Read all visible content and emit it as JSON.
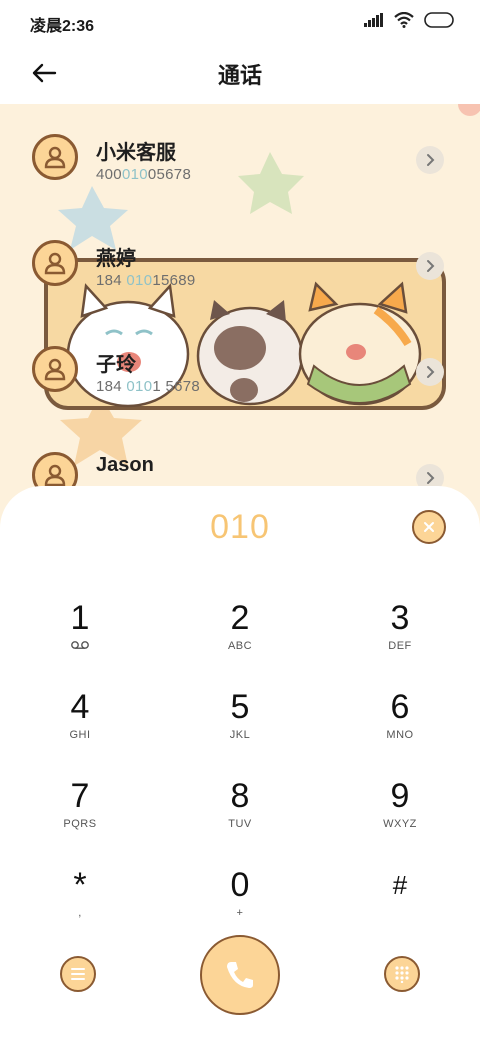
{
  "status_bar": {
    "time": "凌晨2:36"
  },
  "header": {
    "title": "通话"
  },
  "contacts": [
    {
      "name": "小米客服",
      "number_pre": "400",
      "number_hl": "010",
      "number_post": "05678"
    },
    {
      "name": "燕婷",
      "number_pre": "184 ",
      "number_hl": "010",
      "number_post": "15689"
    },
    {
      "name": "子玲",
      "number_pre": "184 ",
      "number_hl": "010",
      "number_post": "1 5678"
    },
    {
      "name": "Jason",
      "number_pre": "",
      "number_hl": "",
      "number_post": ""
    }
  ],
  "dialpad": {
    "input": "010",
    "keys": [
      {
        "num": "1",
        "sub": ""
      },
      {
        "num": "2",
        "sub": "ABC"
      },
      {
        "num": "3",
        "sub": "DEF"
      },
      {
        "num": "4",
        "sub": "GHI"
      },
      {
        "num": "5",
        "sub": "JKL"
      },
      {
        "num": "6",
        "sub": "MNO"
      },
      {
        "num": "7",
        "sub": "PQRS"
      },
      {
        "num": "8",
        "sub": "TUV"
      },
      {
        "num": "9",
        "sub": "WXYZ"
      },
      {
        "num": "*",
        "sub": ","
      },
      {
        "num": "0",
        "sub": "+"
      },
      {
        "num": "#",
        "sub": ""
      }
    ]
  },
  "icons": {
    "back": "arrow-left-icon",
    "voicemail": "voicemail-icon",
    "menu": "menu-icon",
    "call": "phone-icon",
    "keypad": "keypad-icon",
    "clear": "close-icon"
  },
  "colors": {
    "accent": "#fcd597",
    "outline": "#8a5a32",
    "digits": "#f7c574",
    "background": "#fdf1dc"
  }
}
